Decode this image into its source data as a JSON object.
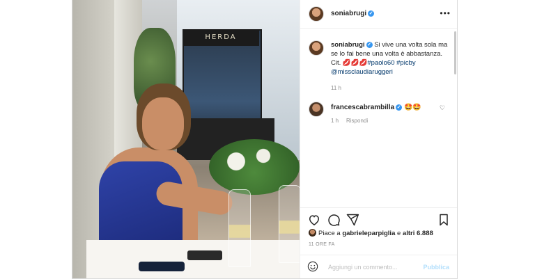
{
  "header": {
    "username": "soniabrugi",
    "more_label": "•••"
  },
  "photo": {
    "sign_text": "HERDA"
  },
  "caption": {
    "username": "soniabrugi",
    "text_1": "Si vive una volta sola ma se lo fai bene una volta è abbastanza. Cit.",
    "emoji": "💋💋💋",
    "tag_1": "#paolo60",
    "tag_2": "#picby",
    "mention": "@missclaudiaruggeri",
    "time": "11 h"
  },
  "comments": [
    {
      "username": "francescabrambilla",
      "text": "🤩🤩",
      "time": "1 h",
      "reply_label": "Rispondi"
    }
  ],
  "likes": {
    "prefix": "Piace a",
    "user": "gabrieleparpiglia",
    "connector": "e",
    "others": "altri 6.888"
  },
  "post_time": "11 ORE FA",
  "add_comment": {
    "placeholder": "Aggiungi un commento...",
    "publish_label": "Pubblica"
  },
  "colors": {
    "link": "#00376b",
    "verified": "#3897f0",
    "publish": "#b2dffc"
  }
}
